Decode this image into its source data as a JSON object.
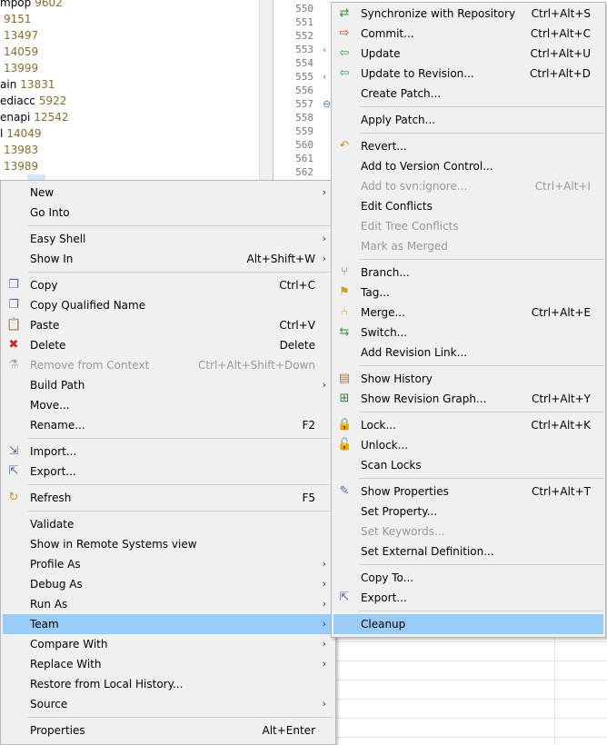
{
  "tree": [
    {
      "name": "mpop",
      "rev": "9602"
    },
    {
      "name": "",
      "rev": "9151"
    },
    {
      "name": "",
      "rev": "13497"
    },
    {
      "name": "",
      "rev": "14059"
    },
    {
      "name": "",
      "rev": "13999"
    },
    {
      "name": "ain",
      "rev": "13831"
    },
    {
      "name": "ediacc",
      "rev": "5922"
    },
    {
      "name": "enapi",
      "rev": "12542"
    },
    {
      "name": "l",
      "rev": "14049"
    },
    {
      "name": "",
      "rev": "13983"
    },
    {
      "name": "",
      "rev": "13989"
    }
  ],
  "editor": {
    "lines": [
      "550",
      "551",
      "552",
      "553",
      "554",
      "555",
      "556",
      "557",
      "558",
      "559",
      "560",
      "561",
      "562"
    ]
  },
  "context_menu": {
    "items": [
      {
        "label": "New",
        "shortcut": "",
        "submenu": true,
        "icon": "",
        "disabled": false
      },
      {
        "label": "Go Into",
        "shortcut": "",
        "submenu": false,
        "icon": "",
        "disabled": false
      },
      {
        "label": "Easy Shell",
        "shortcut": "",
        "submenu": true,
        "icon": "",
        "disabled": false
      },
      {
        "label": "Show In",
        "shortcut": "Alt+Shift+W",
        "submenu": true,
        "icon": "",
        "disabled": false
      },
      {
        "label": "Copy",
        "shortcut": "Ctrl+C",
        "submenu": false,
        "icon": "copy-icon",
        "disabled": false
      },
      {
        "label": "Copy Qualified Name",
        "shortcut": "",
        "submenu": false,
        "icon": "copy-qualified-icon",
        "disabled": false
      },
      {
        "label": "Paste",
        "shortcut": "Ctrl+V",
        "submenu": false,
        "icon": "paste-icon",
        "disabled": false
      },
      {
        "label": "Delete",
        "shortcut": "Delete",
        "submenu": false,
        "icon": "delete-icon",
        "disabled": false
      },
      {
        "label": "Remove from Context",
        "shortcut": "Ctrl+Alt+Shift+Down",
        "submenu": false,
        "icon": "remove-context-icon",
        "disabled": true
      },
      {
        "label": "Build Path",
        "shortcut": "",
        "submenu": true,
        "icon": "",
        "disabled": false
      },
      {
        "label": "Move...",
        "shortcut": "",
        "submenu": false,
        "icon": "",
        "disabled": false
      },
      {
        "label": "Rename...",
        "shortcut": "F2",
        "submenu": false,
        "icon": "",
        "disabled": false
      },
      {
        "label": "Import...",
        "shortcut": "",
        "submenu": false,
        "icon": "import-icon",
        "disabled": false
      },
      {
        "label": "Export...",
        "shortcut": "",
        "submenu": false,
        "icon": "export-icon",
        "disabled": false
      },
      {
        "label": "Refresh",
        "shortcut": "F5",
        "submenu": false,
        "icon": "refresh-icon",
        "disabled": false
      },
      {
        "label": "Validate",
        "shortcut": "",
        "submenu": false,
        "icon": "",
        "disabled": false
      },
      {
        "label": "Show in Remote Systems view",
        "shortcut": "",
        "submenu": false,
        "icon": "",
        "disabled": false
      },
      {
        "label": "Profile As",
        "shortcut": "",
        "submenu": true,
        "icon": "",
        "disabled": false
      },
      {
        "label": "Debug As",
        "shortcut": "",
        "submenu": true,
        "icon": "",
        "disabled": false
      },
      {
        "label": "Run As",
        "shortcut": "",
        "submenu": true,
        "icon": "",
        "disabled": false
      },
      {
        "label": "Team",
        "shortcut": "",
        "submenu": true,
        "icon": "",
        "disabled": false,
        "selected": true
      },
      {
        "label": "Compare With",
        "shortcut": "",
        "submenu": true,
        "icon": "",
        "disabled": false
      },
      {
        "label": "Replace With",
        "shortcut": "",
        "submenu": true,
        "icon": "",
        "disabled": false
      },
      {
        "label": "Restore from Local History...",
        "shortcut": "",
        "submenu": false,
        "icon": "",
        "disabled": false
      },
      {
        "label": "Source",
        "shortcut": "",
        "submenu": true,
        "icon": "",
        "disabled": false
      },
      {
        "label": "Properties",
        "shortcut": "Alt+Enter",
        "submenu": false,
        "icon": "",
        "disabled": false
      }
    ]
  },
  "team_menu": {
    "items": [
      {
        "label": "Synchronize with Repository",
        "shortcut": "Ctrl+Alt+S",
        "icon": "synchronize-icon",
        "disabled": false
      },
      {
        "label": "Commit...",
        "shortcut": "Ctrl+Alt+C",
        "icon": "commit-icon",
        "disabled": false
      },
      {
        "label": "Update",
        "shortcut": "Ctrl+Alt+U",
        "icon": "update-icon",
        "disabled": false
      },
      {
        "label": "Update to Revision...",
        "shortcut": "Ctrl+Alt+D",
        "icon": "update-revision-icon",
        "disabled": false
      },
      {
        "label": "Create Patch...",
        "shortcut": "",
        "icon": "",
        "disabled": false
      },
      {
        "label": "Apply Patch...",
        "shortcut": "",
        "icon": "",
        "disabled": false
      },
      {
        "label": "Revert...",
        "shortcut": "",
        "icon": "revert-icon",
        "disabled": false
      },
      {
        "label": "Add to Version Control...",
        "shortcut": "",
        "icon": "",
        "disabled": false
      },
      {
        "label": "Add to svn:ignore...",
        "shortcut": "Ctrl+Alt+I",
        "icon": "",
        "disabled": true
      },
      {
        "label": "Edit Conflicts",
        "shortcut": "",
        "icon": "",
        "disabled": false
      },
      {
        "label": "Edit Tree Conflicts",
        "shortcut": "",
        "icon": "",
        "disabled": true
      },
      {
        "label": "Mark as Merged",
        "shortcut": "",
        "icon": "",
        "disabled": true
      },
      {
        "label": "Branch...",
        "shortcut": "",
        "icon": "branch-icon",
        "disabled": false
      },
      {
        "label": "Tag...",
        "shortcut": "",
        "icon": "tag-icon",
        "disabled": false
      },
      {
        "label": "Merge...",
        "shortcut": "Ctrl+Alt+E",
        "icon": "merge-icon",
        "disabled": false
      },
      {
        "label": "Switch...",
        "shortcut": "",
        "icon": "switch-icon",
        "disabled": false
      },
      {
        "label": "Add Revision Link...",
        "shortcut": "",
        "icon": "",
        "disabled": false
      },
      {
        "label": "Show History",
        "shortcut": "",
        "icon": "history-icon",
        "disabled": false
      },
      {
        "label": "Show Revision Graph...",
        "shortcut": "Ctrl+Alt+Y",
        "icon": "revision-graph-icon",
        "disabled": false
      },
      {
        "label": "Lock...",
        "shortcut": "Ctrl+Alt+K",
        "icon": "lock-icon",
        "disabled": false
      },
      {
        "label": "Unlock...",
        "shortcut": "",
        "icon": "unlock-icon",
        "disabled": false
      },
      {
        "label": "Scan Locks",
        "shortcut": "",
        "icon": "",
        "disabled": false
      },
      {
        "label": "Show Properties",
        "shortcut": "Ctrl+Alt+T",
        "icon": "properties-icon",
        "disabled": false
      },
      {
        "label": "Set Property...",
        "shortcut": "",
        "icon": "",
        "disabled": false
      },
      {
        "label": "Set Keywords...",
        "shortcut": "",
        "icon": "",
        "disabled": true
      },
      {
        "label": "Set External Definition...",
        "shortcut": "",
        "icon": "",
        "disabled": false
      },
      {
        "label": "Copy To...",
        "shortcut": "",
        "icon": "",
        "disabled": false
      },
      {
        "label": "Export...",
        "shortcut": "",
        "icon": "export-icon",
        "disabled": false
      },
      {
        "label": "Cleanup",
        "shortcut": "",
        "icon": "",
        "disabled": false,
        "selected": true
      }
    ]
  },
  "submenu_arrow": "›"
}
